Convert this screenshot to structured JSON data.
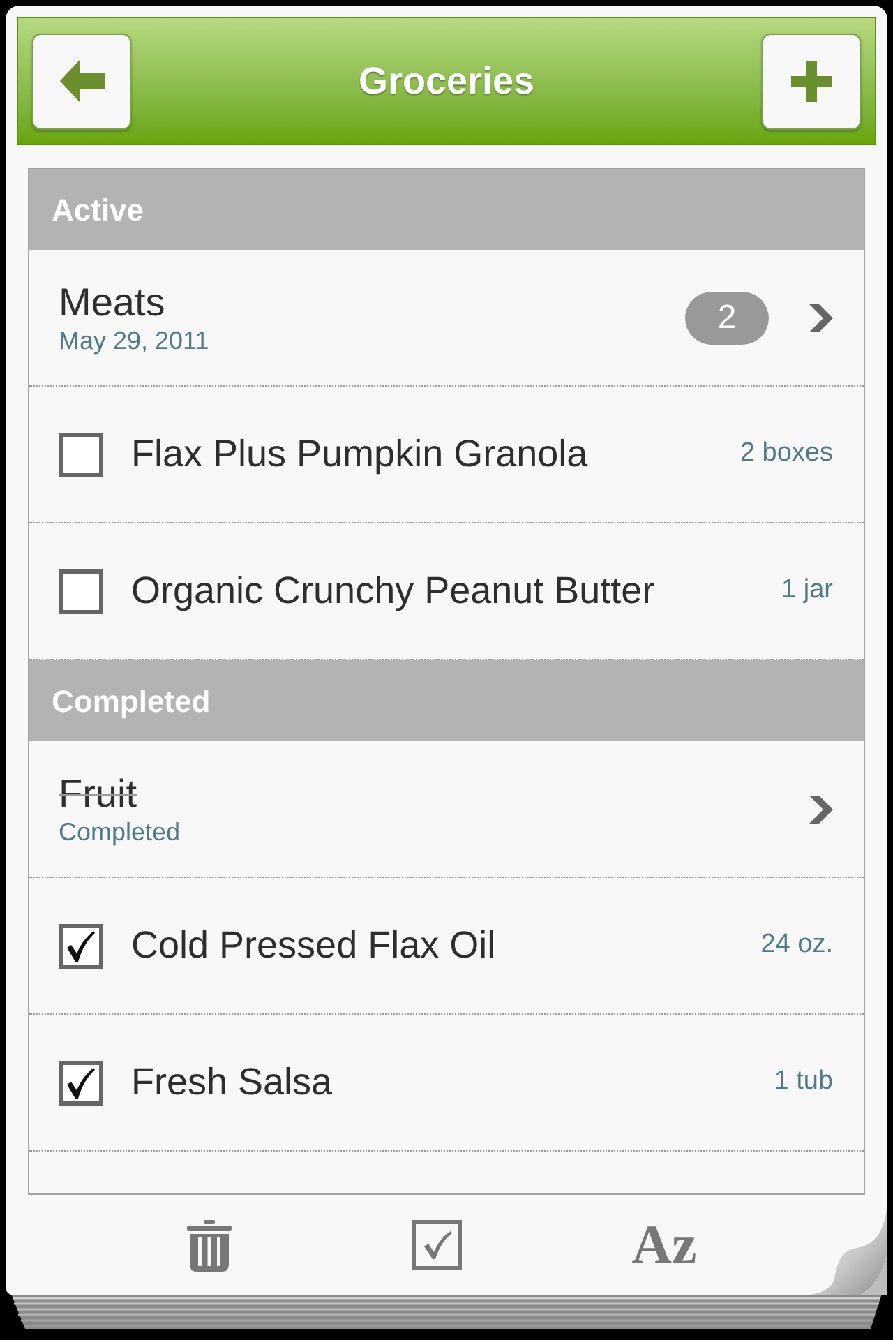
{
  "header": {
    "title": "Groceries"
  },
  "sections": [
    {
      "title": "Active",
      "rows": [
        {
          "kind": "list",
          "name": "Meats",
          "subtitle": "May 29, 2011",
          "count": "2",
          "completed": false
        },
        {
          "kind": "item",
          "name": "Flax Plus Pumpkin Granola",
          "quantity": "2 boxes",
          "checked": false
        },
        {
          "kind": "item",
          "name": "Organic Crunchy Peanut Butter",
          "quantity": "1 jar",
          "checked": false
        }
      ]
    },
    {
      "title": "Completed",
      "rows": [
        {
          "kind": "list",
          "name": "Fruit",
          "subtitle": "Completed",
          "completed": true
        },
        {
          "kind": "item",
          "name": "Cold Pressed Flax Oil",
          "quantity": "24 oz.",
          "checked": true
        },
        {
          "kind": "item",
          "name": "Fresh Salsa",
          "quantity": "1 tub",
          "checked": true
        }
      ]
    }
  ],
  "toolbar": {
    "sort_label": "Az"
  }
}
